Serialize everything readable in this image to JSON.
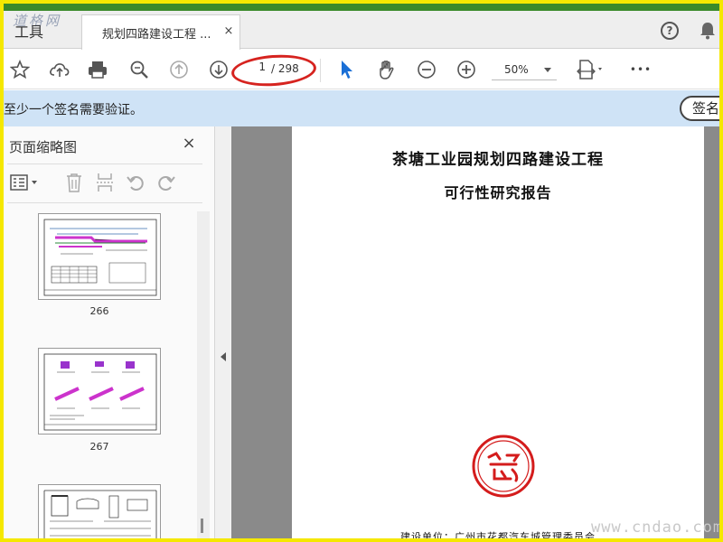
{
  "watermark_top": "道格网",
  "watermark_bottom": "www.cndao.com",
  "tabbar": {
    "tools_label": "工具",
    "doc_tab_title": "规划四路建设工程 ...",
    "close_glyph": "×",
    "help_glyph": "?"
  },
  "toolbar": {
    "current_page": "1",
    "total_pages": "/ 298",
    "zoom": "50%",
    "more_glyph": "•••",
    "highlight_color": "#d6231f",
    "select_color": "#1a6fd6"
  },
  "banner": {
    "text": "至少一个签名需要验证。",
    "button_label": "签名"
  },
  "left_pane": {
    "title": "页面缩略图",
    "close_glyph": "×",
    "thumbnails": [
      {
        "label": "266"
      },
      {
        "label": "267"
      },
      {
        "label": ""
      }
    ]
  },
  "document": {
    "title_line1": "茶塘工业园规划四路建设工程",
    "title_line2": "可行性研究报告",
    "builder": "建设单位：广州市花都汽车城管理委员会"
  }
}
